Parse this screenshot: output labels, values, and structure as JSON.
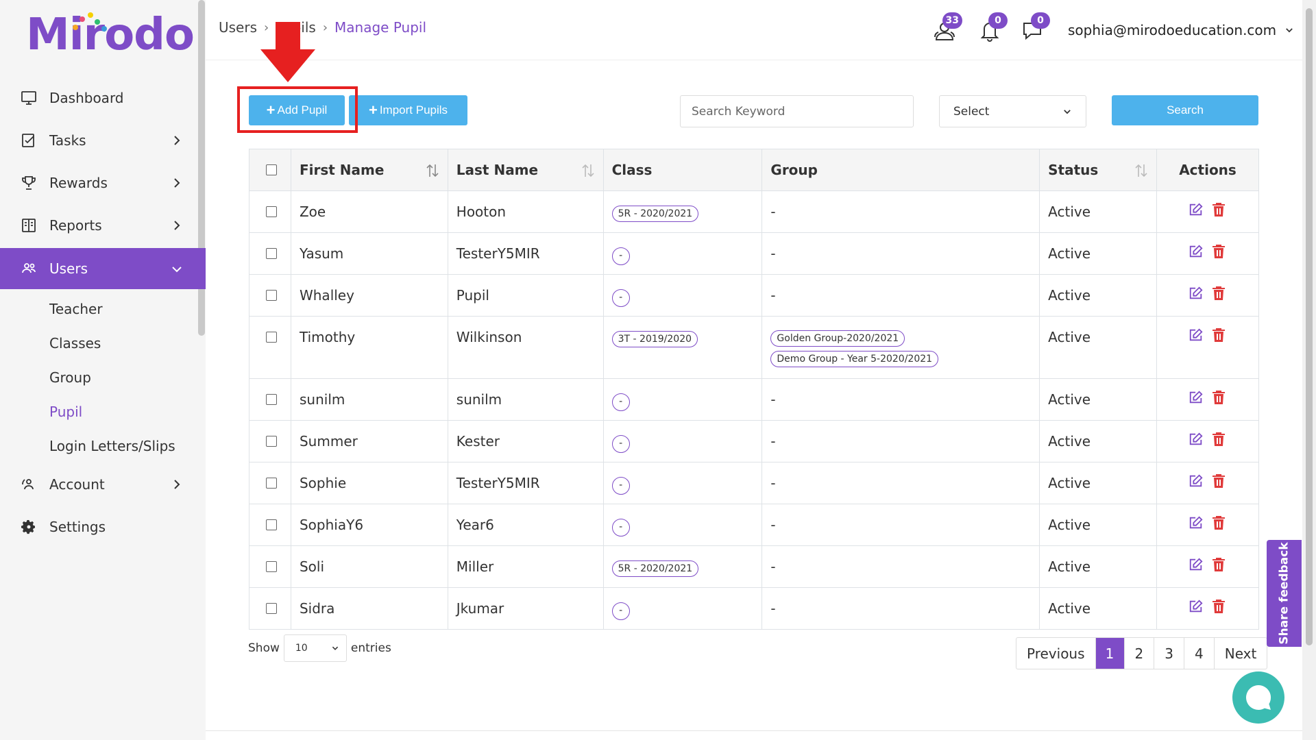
{
  "brand": {
    "name": "Mirodo"
  },
  "sidebar": {
    "items": [
      {
        "label": "Dashboard",
        "icon": "monitor-icon"
      },
      {
        "label": "Tasks",
        "icon": "tasks-icon"
      },
      {
        "label": "Rewards",
        "icon": "trophy-icon"
      },
      {
        "label": "Reports",
        "icon": "reports-icon"
      },
      {
        "label": "Users",
        "icon": "users-icon"
      },
      {
        "label": "Account",
        "icon": "account-icon"
      },
      {
        "label": "Settings",
        "icon": "gear-icon"
      }
    ],
    "users_sub": [
      "Teacher",
      "Classes",
      "Group",
      "Pupil",
      "Login Letters/Slips"
    ]
  },
  "header": {
    "breadcrumb": [
      "Users",
      "Pupils",
      "Manage Pupil"
    ],
    "badges": {
      "pupils": "33",
      "notifications": "0",
      "messages": "0"
    },
    "user_email": "sophia@mirodoeducation.com"
  },
  "toolbar": {
    "add_pupil": "Add Pupil",
    "import_pupils": "Import Pupils",
    "search_placeholder": "Search Keyword",
    "select_value": "Select",
    "search_label": "Search"
  },
  "table": {
    "headers": [
      "First Name",
      "Last Name",
      "Class",
      "Group",
      "Status",
      "Actions"
    ],
    "rows": [
      {
        "first": "Zoe",
        "last": "Hooton",
        "class": "5R - 2020/2021",
        "groups": [],
        "status": "Active"
      },
      {
        "first": "Yasum",
        "last": "TesterY5MIR",
        "class": "-",
        "groups": [],
        "status": "Active"
      },
      {
        "first": "Whalley",
        "last": "Pupil",
        "class": "-",
        "groups": [],
        "status": "Active"
      },
      {
        "first": "Timothy",
        "last": "Wilkinson",
        "class": "3T - 2019/2020",
        "groups": [
          "Golden Group-2020/2021",
          "Demo Group - Year 5-2020/2021"
        ],
        "status": "Active"
      },
      {
        "first": "sunilm",
        "last": "sunilm",
        "class": "-",
        "groups": [],
        "status": "Active"
      },
      {
        "first": "Summer",
        "last": "Kester",
        "class": "-",
        "groups": [],
        "status": "Active"
      },
      {
        "first": "Sophie",
        "last": "TesterY5MIR",
        "class": "-",
        "groups": [],
        "status": "Active"
      },
      {
        "first": "SophiaY6",
        "last": "Year6",
        "class": "-",
        "groups": [],
        "status": "Active"
      },
      {
        "first": "Soli",
        "last": "Miller",
        "class": "5R - 2020/2021",
        "groups": [],
        "status": "Active"
      },
      {
        "first": "Sidra",
        "last": "Jkumar",
        "class": "-",
        "groups": [],
        "status": "Active"
      }
    ],
    "empty_group": "-"
  },
  "footer": {
    "show_label": "Show",
    "entries_value": "10",
    "entries_label": "entries",
    "pagination": [
      "Previous",
      "1",
      "2",
      "3",
      "4",
      "Next"
    ]
  },
  "feedback_label": "Share feedback",
  "colors": {
    "accent": "#7e4cc7",
    "button": "#4db2ec",
    "danger": "#e03a3a",
    "annotation": "#e62020",
    "chat": "#3bbcb2"
  }
}
